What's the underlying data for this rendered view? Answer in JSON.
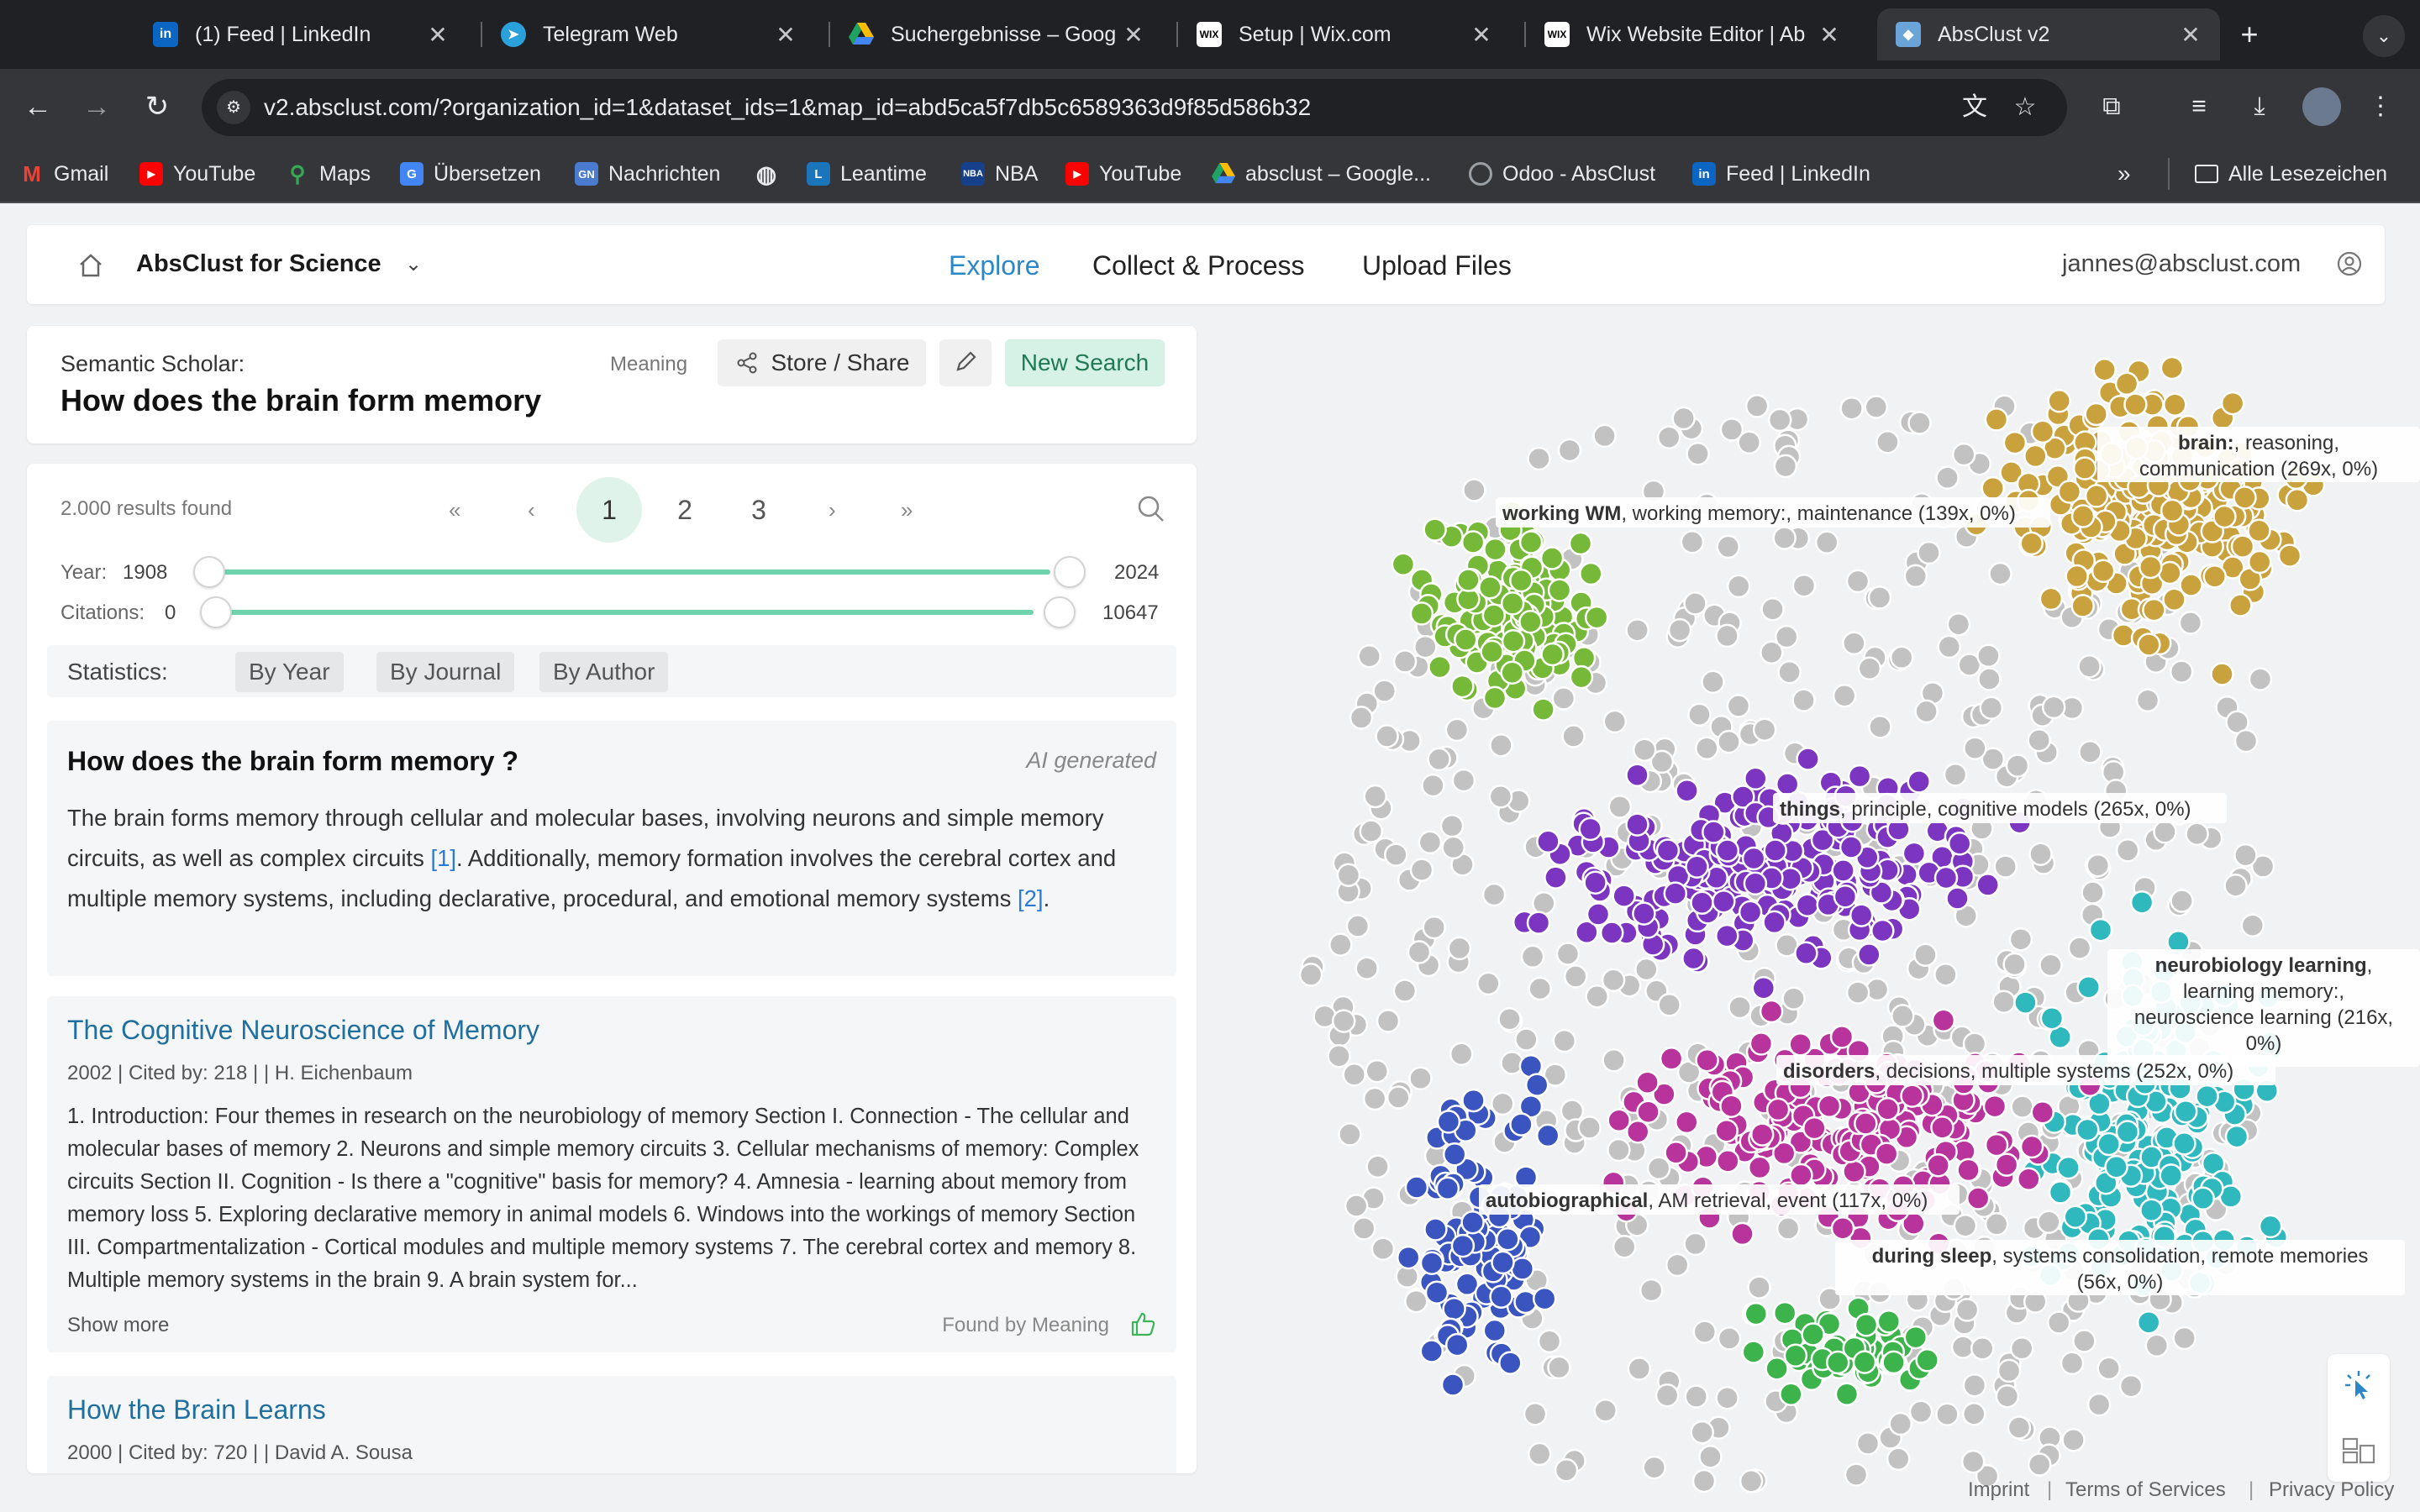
{
  "browser": {
    "tabs": [
      {
        "title": "(1) Feed | LinkedIn",
        "icon": "linkedin-icon"
      },
      {
        "title": "Telegram Web",
        "icon": "telegram-icon"
      },
      {
        "title": "Suchergebnisse – Goog",
        "icon": "google-drive-icon"
      },
      {
        "title": "Setup | Wix.com",
        "icon": "wix-icon"
      },
      {
        "title": "Wix Website Editor | Ab",
        "icon": "wix-icon"
      },
      {
        "title": "AbsClust v2",
        "icon": "absclust-icon"
      }
    ],
    "url": "v2.absclust.com/?organization_id=1&dataset_ids=1&map_id=abd5ca5f7db5c6589363d9f85d586b32",
    "bookmarks": [
      {
        "label": "Gmail",
        "icon": "gmail-icon"
      },
      {
        "label": "YouTube",
        "icon": "youtube-icon"
      },
      {
        "label": "Maps",
        "icon": "maps-icon"
      },
      {
        "label": "Übersetzen",
        "icon": "translate-icon"
      },
      {
        "label": "Nachrichten",
        "icon": "news-icon"
      },
      {
        "label": "",
        "icon": "globe-icon"
      },
      {
        "label": "Leantime",
        "icon": "leantime-icon"
      },
      {
        "label": "NBA",
        "icon": "nba-icon"
      },
      {
        "label": "YouTube",
        "icon": "youtube-icon"
      },
      {
        "label": "absclust – Google...",
        "icon": "google-drive-icon"
      },
      {
        "label": "Odoo - AbsClust",
        "icon": "odoo-icon"
      },
      {
        "label": "Feed | LinkedIn",
        "icon": "linkedin-icon"
      }
    ],
    "all_bookmarks": "Alle Lesezeichen"
  },
  "app": {
    "org": "AbsClust for Science",
    "nav": [
      "Explore",
      "Collect & Process",
      "Upload Files"
    ],
    "user": "jannes@absclust.com"
  },
  "search": {
    "source": "Semantic Scholar:",
    "query": "How does the brain form memory",
    "mode": "Meaning",
    "share_label": "Store / Share",
    "new_search_label": "New Search"
  },
  "results": {
    "count": "2.000 results found",
    "pages": [
      "1",
      "2",
      "3"
    ],
    "current_page": "1",
    "year_label": "Year:",
    "year_min": "1908",
    "year_max": "2024",
    "citations_label": "Citations:",
    "citations_min": "0",
    "citations_max": "10647",
    "stats_label": "Statistics:",
    "stats_buttons": [
      "By Year",
      "By Journal",
      "By Author"
    ]
  },
  "ai": {
    "question": "How does the brain form memory ?",
    "tag": "AI generated",
    "text_1": "The brain forms memory through cellular and molecular bases, involving neurons and simple memory circuits, as well as complex circuits ",
    "ref_1": "[1]",
    "text_2": ". Additionally, memory formation involves the cerebral cortex and multiple memory systems, including declarative, procedural, and emotional memory systems ",
    "ref_2": "[2]",
    "text_3": "."
  },
  "papers": [
    {
      "title": "The Cognitive Neuroscience of Memory",
      "meta": "2002 | Cited by: 218 | | H. Eichenbaum",
      "abstract": "1. Introduction: Four themes in research on the neurobiology of memory Section I. Connection - The cellular and molecular bases of memory 2. Neurons and simple memory circuits 3. Cellular mechanisms of memory: Complex circuits Section II. Cognition - Is there a \"cognitive\" basis for memory? 4. Amnesia - learning about memory from memory loss 5. Exploring declarative memory in animal models 6. Windows into the workings of memory Section III. Compartmentalization - Cortical modules and multiple memory systems 7. The cerebral cortex and memory 8. Multiple memory systems in the brain 9. A brain system for...",
      "show_more": "Show more",
      "found_by": "Found by Meaning"
    },
    {
      "title": "How the Brain Learns",
      "meta": "2000 | Cited by: 720 | | David A. Sousa"
    }
  ],
  "map": {
    "clusters": [
      {
        "bold": "brain:",
        "rest": ", reasoning,",
        "line2": "communication (269x, 0%)",
        "color": "#c9a23d"
      },
      {
        "bold": "working WM",
        "rest": ", working memory:, maintenance (139x, 0%)",
        "line2": "",
        "color": "#76b939"
      },
      {
        "bold": "things",
        "rest": ", principle, cognitive models (265x, 0%)",
        "line2": "",
        "color": "#7b35c1"
      },
      {
        "bold": "neurobiology learning",
        "rest": ",",
        "line2": "learning memory:,",
        "line3": "neuroscience learning (216x,",
        "line4": "0%)",
        "color": "#2fb8bd"
      },
      {
        "bold": "disorders",
        "rest": ", decisions, multiple systems (252x, 0%)",
        "line2": "",
        "color": "#b8339b"
      },
      {
        "bold": "autobiographical",
        "rest": ", AM retrieval, event (117x, 0%)",
        "line2": "",
        "color": "#3b55c0"
      },
      {
        "bold": "during sleep",
        "rest": ", systems consolidation, remote memories",
        "line2": "(56x, 0%)",
        "color": "#3cb44b"
      }
    ],
    "unclustered_color": "#c2c2c2"
  },
  "footer": [
    "Imprint",
    "Terms of Services",
    "Privacy Policy"
  ],
  "colors": {
    "accent": "#2b87c8",
    "slider": "#6fd3ae",
    "new_search_bg": "#d6f2e6"
  }
}
